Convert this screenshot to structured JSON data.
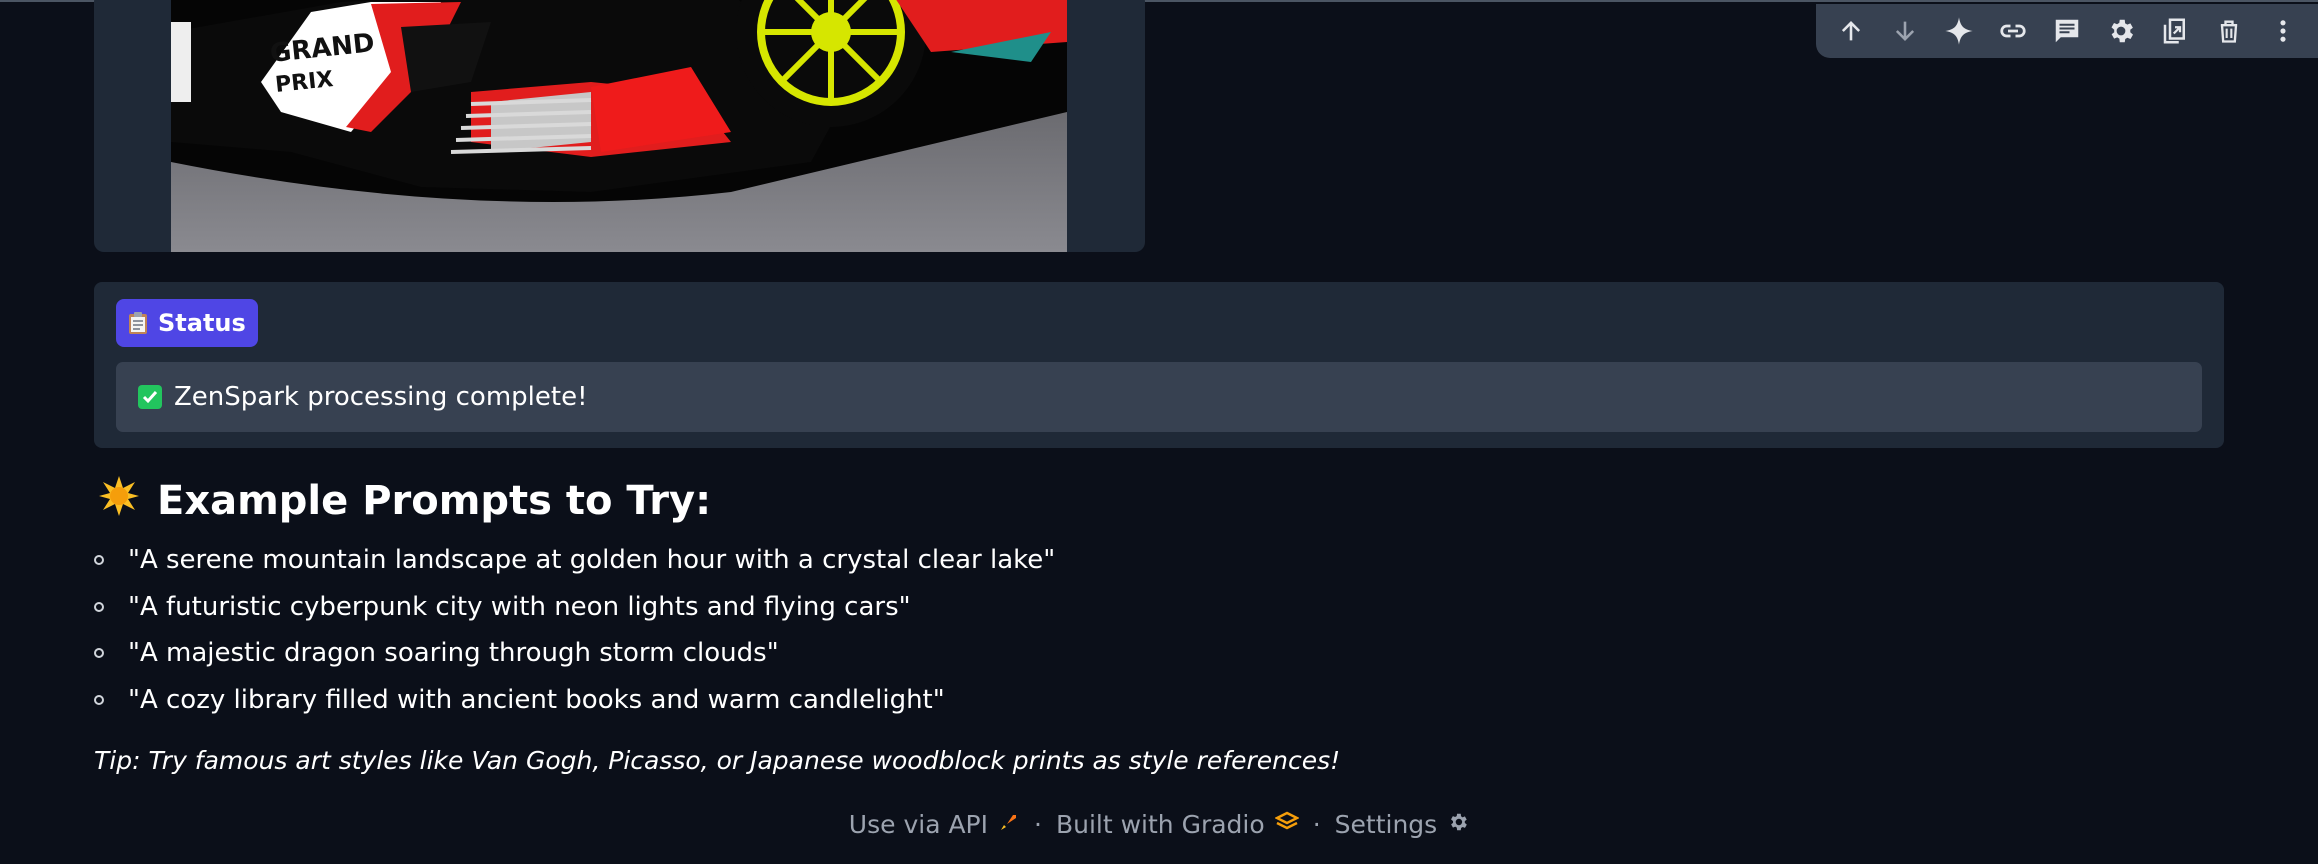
{
  "status": {
    "label": "Status",
    "message": "ZenSpark processing complete!"
  },
  "examples": {
    "heading": "Example Prompts to Try:",
    "prompts": [
      "\"A serene mountain landscape at golden hour with a crystal clear lake\"",
      "\"A futuristic cyberpunk city with neon lights and flying cars\"",
      "\"A majestic dragon soaring through storm clouds\"",
      "\"A cozy library filled with ancient books and warm candlelight\""
    ],
    "tip": "Tip: Try famous art styles like Van Gogh, Picasso, or Japanese woodblock prints as style references!"
  },
  "footer": {
    "api": "Use via API",
    "built": "Built with Gradio",
    "settings": "Settings",
    "separator": "·"
  },
  "image_text": "GRAND PRIX",
  "toolbar": {
    "icons": [
      "arrow-up-icon",
      "arrow-down-icon",
      "sparkle-icon",
      "link-icon",
      "comment-icon",
      "gear-icon",
      "copy-icon",
      "trash-icon",
      "more-vert-icon"
    ]
  },
  "colors": {
    "background": "#0b0f19",
    "panel": "#1f2937",
    "accent": "#4f46e5",
    "status_box": "#374151",
    "success": "#22c55e"
  }
}
